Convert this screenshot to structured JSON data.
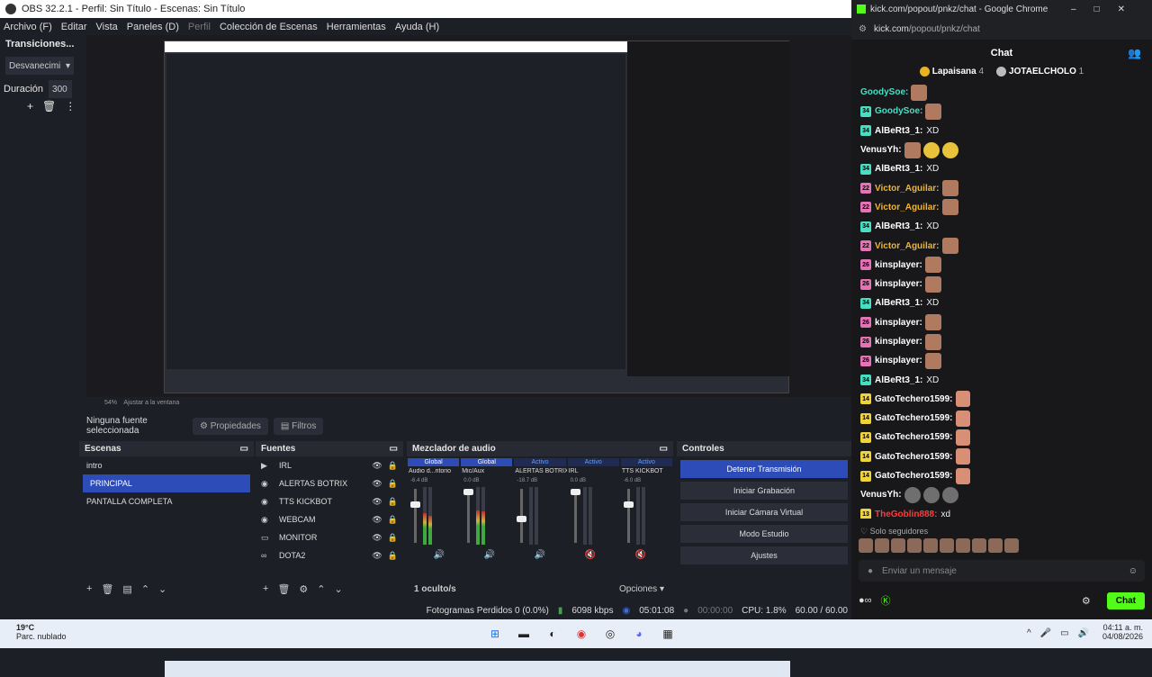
{
  "obs": {
    "title": "OBS 32.2.1 - Perfil: Sin Título - Escenas: Sin Título",
    "menu": [
      "Archivo (F)",
      "Editar",
      "Vista",
      "Paneles (D)",
      "Perfil",
      "Colección de Escenas",
      "Herramientas",
      "Ayuda (H)"
    ],
    "transitions": {
      "title": "Transiciones...",
      "type": "Desvanecimi",
      "duration_label": "Duración",
      "duration": "300"
    },
    "zoom": "54%",
    "fit": "Ajustar a la ventana",
    "no_source": "Ninguna fuente seleccionada",
    "properties": "Propiedades",
    "filters": "Filtros",
    "scenes": {
      "title": "Escenas",
      "items": [
        "intro",
        "PRINCIPAL",
        "PANTALLA COMPLETA"
      ]
    },
    "sources": {
      "title": "Fuentes",
      "items": [
        "IRL",
        "ALERTAS BOTRIX",
        "TTS KICKBOT",
        "WEBCAM",
        "MONITOR",
        "DOTA2"
      ]
    },
    "mixer": {
      "title": "Mezclador de audio",
      "heads": [
        "Global",
        "Global",
        "Activo",
        "Activo",
        "Activo"
      ],
      "channels": [
        "Audio d...ritorio",
        "Mic/Aux",
        "ALERTAS BOTRIX",
        "IRL",
        "TTS KICKBOT"
      ],
      "db": [
        "-6.4 dB",
        "0.0 dB",
        "-18.7 dB",
        "0.0 dB",
        "-6.0 dB"
      ],
      "hidden": "1 oculto/s",
      "options": "Opciones"
    },
    "controls": {
      "title": "Controles",
      "buttons": [
        "Detener Transmisión",
        "Iniciar Grabación",
        "Iniciar Cámara Virtual",
        "Modo Estudio",
        "Ajustes"
      ]
    },
    "status": {
      "frames": "Fotogramas Perdidos 0 (0.0%)",
      "kbps": "6098 kbps",
      "time1": "05:01:08",
      "time2": "00:00:00",
      "cpu": "CPU: 1.8%",
      "fps": "60.00 / 60.00"
    }
  },
  "chat": {
    "window_title": "kick.com/popout/pnkz/chat - Google Chrome",
    "url_host": "kick.com",
    "url_path": "/popout/pnkz/chat",
    "header": "Chat",
    "pinned": [
      {
        "name": "Lapaisana",
        "count": "4"
      },
      {
        "name": "JOTAELCHOLO",
        "count": "1"
      }
    ],
    "messages": [
      {
        "badge": "",
        "user": "GoodySoe:",
        "color": "#45e0c4",
        "text": "",
        "emotes": 1
      },
      {
        "badge": "34",
        "user": "GoodySoe:",
        "color": "#45e0c4",
        "text": "",
        "emotes": 1
      },
      {
        "badge": "34",
        "user": "AlBeRt3_1:",
        "color": "#ffffff",
        "text": "XD",
        "emotes": 0
      },
      {
        "badge": "",
        "user": "VenusYh:",
        "color": "#ffffff",
        "text": "",
        "emotes": 3
      },
      {
        "badge": "34",
        "user": "AlBeRt3_1:",
        "color": "#ffffff",
        "text": "XD",
        "emotes": 0
      },
      {
        "badge": "22",
        "user": "Victor_Aguilar:",
        "color": "#f0b52e",
        "text": "",
        "emotes": 1
      },
      {
        "badge": "22",
        "user": "Victor_Aguilar:",
        "color": "#f0b52e",
        "text": "",
        "emotes": 1
      },
      {
        "badge": "34",
        "user": "AlBeRt3_1:",
        "color": "#ffffff",
        "text": "XD",
        "emotes": 0
      },
      {
        "badge": "22",
        "user": "Victor_Aguilar:",
        "color": "#f0b52e",
        "text": "",
        "emotes": 1
      },
      {
        "badge": "26",
        "user": "kinsplayer:",
        "color": "#ffffff",
        "text": "",
        "emotes": 1
      },
      {
        "badge": "26",
        "user": "kinsplayer:",
        "color": "#ffffff",
        "text": "",
        "emotes": 1
      },
      {
        "badge": "34",
        "user": "AlBeRt3_1:",
        "color": "#ffffff",
        "text": "XD",
        "emotes": 0
      },
      {
        "badge": "26",
        "user": "kinsplayer:",
        "color": "#ffffff",
        "text": "",
        "emotes": 1
      },
      {
        "badge": "26",
        "user": "kinsplayer:",
        "color": "#ffffff",
        "text": "",
        "emotes": 1
      },
      {
        "badge": "26",
        "user": "kinsplayer:",
        "color": "#ffffff",
        "text": "",
        "emotes": 1
      },
      {
        "badge": "34",
        "user": "AlBeRt3_1:",
        "color": "#ffffff",
        "text": "XD",
        "emotes": 0
      },
      {
        "badge": "14",
        "user": "GatoTechero1599:",
        "color": "#ffffff",
        "text": "",
        "emotes": 1
      },
      {
        "badge": "14",
        "user": "GatoTechero1599:",
        "color": "#ffffff",
        "text": "",
        "emotes": 1
      },
      {
        "badge": "14",
        "user": "GatoTechero1599:",
        "color": "#ffffff",
        "text": "",
        "emotes": 1
      },
      {
        "badge": "14",
        "user": "GatoTechero1599:",
        "color": "#ffffff",
        "text": "",
        "emotes": 1
      },
      {
        "badge": "14",
        "user": "GatoTechero1599:",
        "color": "#ffffff",
        "text": "",
        "emotes": 1
      },
      {
        "badge": "",
        "user": "VenusYh:",
        "color": "#ffffff",
        "text": "",
        "emotes": 3
      },
      {
        "badge": "13",
        "user": "TheGoblin888:",
        "color": "#ff3b3b",
        "text": "xd",
        "emotes": 0
      }
    ],
    "subs_only": "Solo seguidores",
    "input_placeholder": "Enviar un mensaje",
    "chat_button": "Chat"
  },
  "taskbar": {
    "temp": "19°C",
    "weather": "Parc. nublado",
    "time": "04:11 a. m.",
    "date": "04/08/2026"
  }
}
